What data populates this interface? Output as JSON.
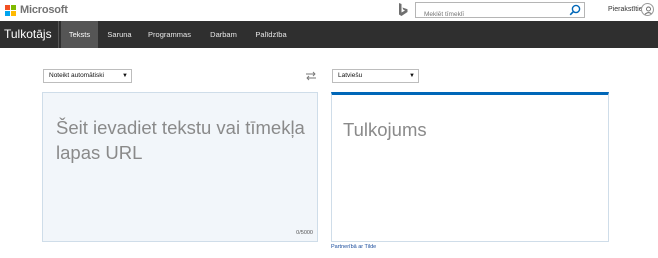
{
  "header": {
    "brand_name": "Microsoft",
    "search_placeholder": "Meklēt tīmeklī",
    "signin_label": "Pierakstīties"
  },
  "nav": {
    "title": "Tulkotājs",
    "tabs": [
      {
        "label": "Teksts",
        "active": true
      },
      {
        "label": "Saruna",
        "active": false
      },
      {
        "label": "Programmas",
        "active": false
      },
      {
        "label": "Darbam",
        "active": false
      },
      {
        "label": "Palīdzība",
        "active": false
      }
    ]
  },
  "translator": {
    "source_language": "Noteikt automātiski",
    "target_language": "Latviešu",
    "source_placeholder": "Šeit ievadiet tekstu vai tīmekļa lapas URL",
    "char_count": "0/5000",
    "target_placeholder": "Tulkojums",
    "partner_text": "Partnerībā ar Tilde"
  },
  "colors": {
    "nav_background": "#2f2f2f",
    "active_tab": "#555555",
    "accent_blue": "#0067b8",
    "source_box_bg": "#f2f6fa"
  }
}
